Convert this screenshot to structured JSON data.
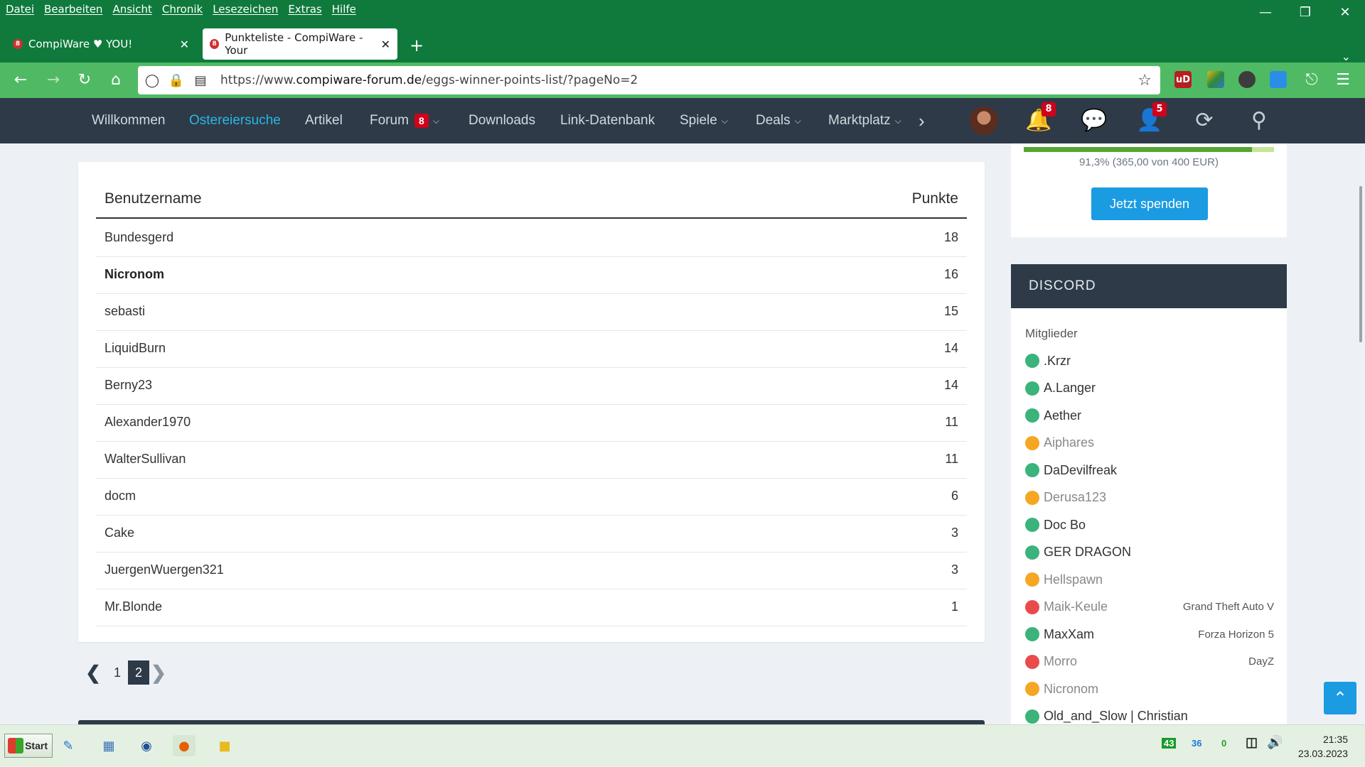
{
  "browser": {
    "menu": [
      "Datei",
      "Bearbeiten",
      "Ansicht",
      "Chronik",
      "Lesezeichen",
      "Extras",
      "Hilfe"
    ],
    "tabs": [
      {
        "label": "CompiWare ♥ YOU!",
        "badge": "8"
      },
      {
        "label": "Punkteliste - CompiWare - Your",
        "badge": "8"
      }
    ],
    "url_prefix": "https://www.",
    "url_domain": "compiware-forum.de",
    "url_path": "/eggs-winner-points-list/?pageNo=2",
    "ublock_badge": "uD"
  },
  "site_nav": {
    "items": [
      {
        "label": "Willkommen"
      },
      {
        "label": "Ostereiersuche",
        "active": true
      },
      {
        "label": "Artikel"
      },
      {
        "label": "Forum",
        "badge": "8"
      },
      {
        "label": "Downloads"
      },
      {
        "label": "Link-Datenbank"
      },
      {
        "label": "Spiele"
      },
      {
        "label": "Deals"
      },
      {
        "label": "Marktplatz"
      }
    ],
    "notifications_count": "8",
    "friends_count": "5"
  },
  "table": {
    "col_user": "Benutzername",
    "col_points": "Punkte",
    "rows": [
      {
        "name": "Bundesgerd",
        "points": "18"
      },
      {
        "name": "Nicronom",
        "points": "16"
      },
      {
        "name": "sebasti",
        "points": "15"
      },
      {
        "name": "LiquidBurn",
        "points": "14"
      },
      {
        "name": "Berny23",
        "points": "14"
      },
      {
        "name": "Alexander1970",
        "points": "11"
      },
      {
        "name": "WalterSullivan",
        "points": "11"
      },
      {
        "name": "docm",
        "points": "6"
      },
      {
        "name": "Cake",
        "points": "3"
      },
      {
        "name": "JuergenWuergen321",
        "points": "3"
      },
      {
        "name": "Mr.Blonde",
        "points": "1"
      }
    ]
  },
  "pagination": {
    "pages": [
      "1",
      "2"
    ],
    "current": "2"
  },
  "donation": {
    "progress_fraction": 0.913,
    "progress_text": "91,3% (365,00 von 400 EUR)",
    "button": "Jetzt spenden"
  },
  "discord": {
    "title": "DISCORD",
    "subtitle": "Mitglieder",
    "status_colors": {
      "online": "#3bb37a",
      "idle": "#f5a623",
      "dnd": "#e94b4b"
    },
    "members": [
      {
        "name": ".Krzr",
        "status": "online",
        "game": ""
      },
      {
        "name": "A.Langer",
        "status": "online",
        "game": ""
      },
      {
        "name": "Aether",
        "status": "online",
        "game": ""
      },
      {
        "name": "Aiphares",
        "status": "idle",
        "game": ""
      },
      {
        "name": "DaDevilfreak",
        "status": "online",
        "game": ""
      },
      {
        "name": "Derusa123",
        "status": "idle",
        "game": ""
      },
      {
        "name": "Doc Bo",
        "status": "online",
        "game": ""
      },
      {
        "name": "GER DRAGON",
        "status": "online",
        "game": ""
      },
      {
        "name": "Hellspawn",
        "status": "idle",
        "game": ""
      },
      {
        "name": "Maik-Keule",
        "status": "dnd",
        "game": "Grand Theft Auto V"
      },
      {
        "name": "MaxXam",
        "status": "online",
        "game": "Forza Horizon 5"
      },
      {
        "name": "Morro",
        "status": "dnd",
        "game": "DayZ"
      },
      {
        "name": "Nicronom",
        "status": "idle",
        "game": ""
      },
      {
        "name": "Old_and_Slow | Christian",
        "status": "online",
        "game": ""
      }
    ]
  },
  "taskbar": {
    "start": "Start",
    "tray": [
      "43",
      "36",
      "0"
    ],
    "time": "21:35",
    "date": "23.03.2023"
  }
}
